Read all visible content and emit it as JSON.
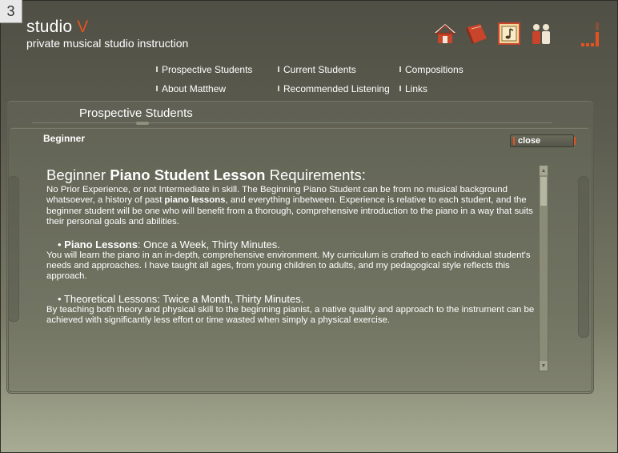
{
  "page_number": "3",
  "site": {
    "name_prefix": "studio",
    "name_accent": "V",
    "tagline": "private musical studio instruction",
    "accent_color": "#e2541f"
  },
  "top_icons": [
    "home-icon",
    "book-icon",
    "music-note-icon",
    "people-icon"
  ],
  "nav": {
    "prospective": "Prospective Students",
    "current": "Current Students",
    "compositions": "Compositions",
    "about": "About Matthew",
    "listening": "Recommended Listening",
    "links": "Links"
  },
  "panel": {
    "title": "Prospective Students",
    "section": "Beginner",
    "close_label": "close"
  },
  "content": {
    "heading_pre": "Beginner ",
    "heading_bold": "Piano Student Lesson",
    "heading_post": " Requirements:",
    "intro_1": "No Prior Experience, or not Intermediate in skill.  The Beginning Piano Student can be from no musical background whatsoever, a history of past ",
    "intro_bold": "piano lessons",
    "intro_2": ", and everything inbetween.  Experience is relative to each student, and the beginner student will be one who will benefit from a thorough, comprehensive introduction to the piano in a way that suits their personal goals and abilities.",
    "item1_bullet": "• ",
    "item1_bold": "Piano Lessons",
    "item1_rest": ": Once a Week, Thirty Minutes.",
    "item1_text": "You will learn the piano in an in-depth, comprehensive environment.  My curriculum is crafted to each individual student's needs and approaches.  I have taught all ages, from young children to adults, and my pedagogical style reflects this approach.",
    "item2_head": "• Theoretical Lessons:  Twice a Month, Thirty Minutes.",
    "item2_text": "By teaching both theory and physical skill to the beginning pianist, a native quality and approach to the instrument can be achieved with significantly less effort or time wasted when simply a physical exercise."
  }
}
